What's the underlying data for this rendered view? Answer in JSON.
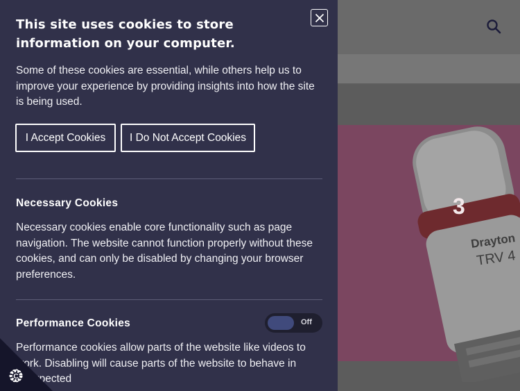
{
  "background": {
    "trv_dial": "3",
    "trv_brand": "Drayton",
    "trv_model": "TRV 4"
  },
  "cookie_panel": {
    "title": "This site uses cookies to store information on your computer.",
    "intro": "Some of these cookies are essential, while others help us to improve your experience by providing insights into how the site is being used.",
    "accept_label": "I Accept Cookies",
    "reject_label": "I Do Not Accept Cookies",
    "necessary": {
      "title": "Necessary Cookies",
      "body": "Necessary cookies enable core functionality such as page navigation. The website cannot function properly without these cookies, and can only be disabled by changing your browser preferences."
    },
    "performance": {
      "title": "Performance Cookies",
      "toggle_state": "Off",
      "body": "Performance cookies allow parts of the website like videos to work. Disabling will cause parts of the website to behave in unexpected"
    }
  },
  "colors": {
    "panel_bg": "#31314a",
    "toggle_knob": "#404a7c"
  }
}
